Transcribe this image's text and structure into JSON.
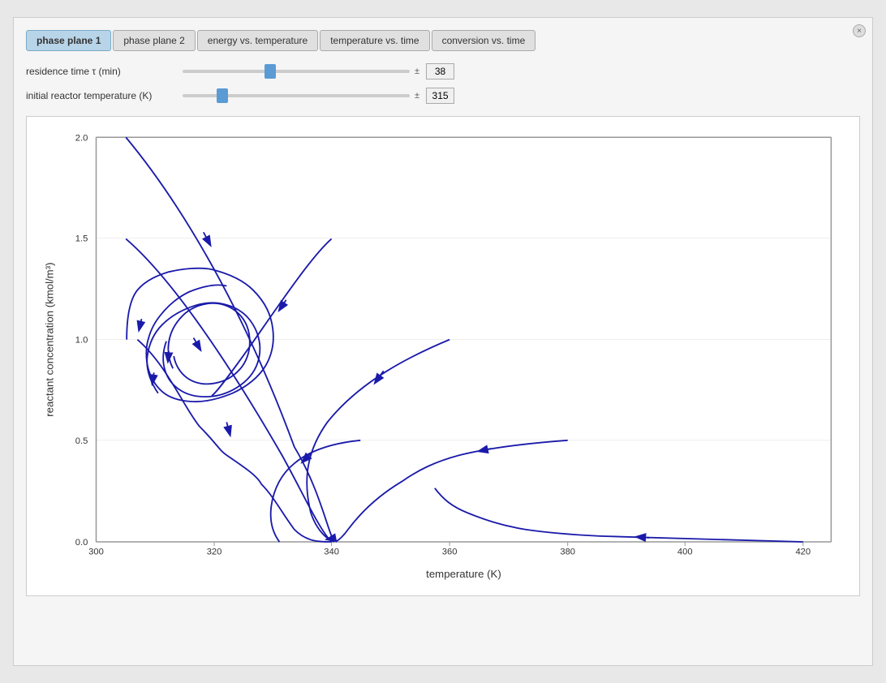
{
  "window": {
    "close_button_label": "×"
  },
  "tabs": [
    {
      "id": "phase-plane-1",
      "label": "phase plane 1",
      "active": true
    },
    {
      "id": "phase-plane-2",
      "label": "phase plane 2",
      "active": false
    },
    {
      "id": "energy-vs-temp",
      "label": "energy vs. temperature",
      "active": false
    },
    {
      "id": "temp-vs-time",
      "label": "temperature vs. time",
      "active": false
    },
    {
      "id": "conversion-vs-time",
      "label": "conversion vs. time",
      "active": false
    }
  ],
  "controls": {
    "residence_time": {
      "label": "residence time τ (min)",
      "value": 38,
      "min": 0,
      "max": 100,
      "position": 38
    },
    "initial_temp": {
      "label": "initial reactor temperature (K)",
      "value": 315,
      "min": 290,
      "max": 450,
      "position": 315
    }
  },
  "chart": {
    "x_axis_label": "temperature (K)",
    "y_axis_label": "reactant concentration (kmol/m³)",
    "x_min": 300,
    "x_max": 425,
    "y_min": 0,
    "y_max": 2.0,
    "x_ticks": [
      300,
      320,
      340,
      360,
      380,
      400,
      420
    ],
    "y_ticks": [
      0.0,
      0.5,
      1.0,
      1.5,
      2.0
    ]
  }
}
